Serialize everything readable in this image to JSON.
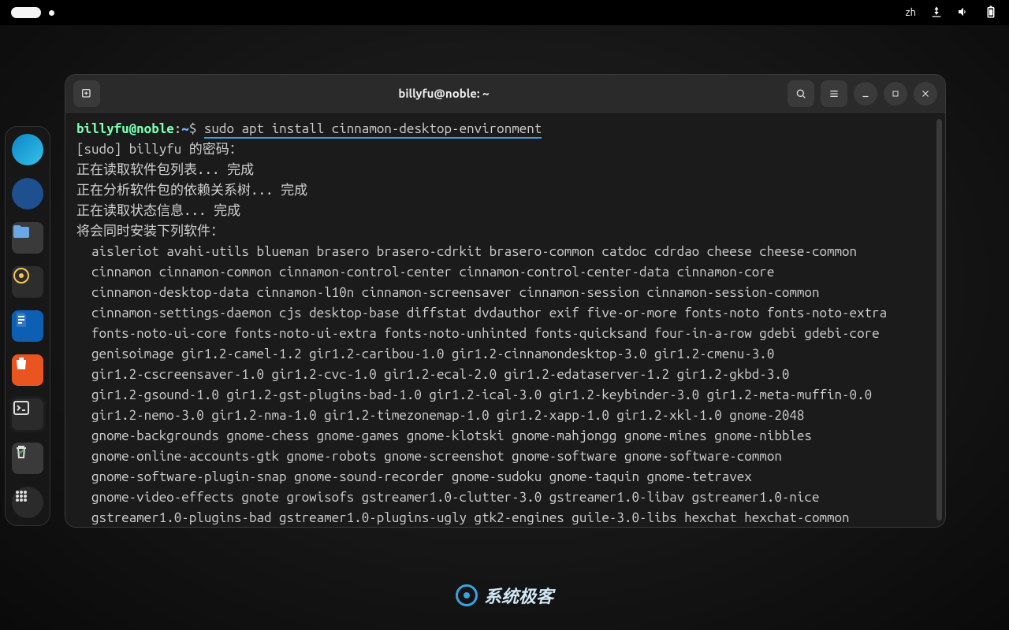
{
  "topbar": {
    "lang": "zh"
  },
  "dock": {
    "items": [
      {
        "name": "edge-browser-icon"
      },
      {
        "name": "thunderbird-icon"
      },
      {
        "name": "files-icon"
      },
      {
        "name": "rhythmbox-icon"
      },
      {
        "name": "libreoffice-writer-icon"
      },
      {
        "name": "software-store-icon"
      },
      {
        "name": "terminal-icon"
      },
      {
        "name": "trash-icon"
      },
      {
        "name": "app-grid-icon"
      }
    ]
  },
  "window": {
    "title": "billyfu@noble: ~"
  },
  "prompt": {
    "user": "billyfu@noble",
    "sep": ":",
    "path": "~",
    "dollar": "$",
    "command": "sudo apt install cinnamon-desktop-environment"
  },
  "lines": {
    "sudo_prompt": "[sudo] billyfu 的密码：",
    "read_pkgs": "正在读取软件包列表... 完成",
    "dep_tree": "正在分析软件包的依赖关系树... 完成",
    "read_state": "正在读取状态信息... 完成",
    "will_install": "将会同时安装下列软件：",
    "pkg01": "aisleriot avahi-utils blueman brasero brasero-cdrkit brasero-common catdoc cdrdao cheese cheese-common",
    "pkg02": "cinnamon cinnamon-common cinnamon-control-center cinnamon-control-center-data cinnamon-core",
    "pkg03": "cinnamon-desktop-data cinnamon-l10n cinnamon-screensaver cinnamon-session cinnamon-session-common",
    "pkg04": "cinnamon-settings-daemon cjs desktop-base diffstat dvdauthor exif five-or-more fonts-noto fonts-noto-extra",
    "pkg05": "fonts-noto-ui-core fonts-noto-ui-extra fonts-noto-unhinted fonts-quicksand four-in-a-row gdebi gdebi-core",
    "pkg06": "genisoimage gir1.2-camel-1.2 gir1.2-caribou-1.0 gir1.2-cinnamondesktop-3.0 gir1.2-cmenu-3.0",
    "pkg07": "gir1.2-cscreensaver-1.0 gir1.2-cvc-1.0 gir1.2-ecal-2.0 gir1.2-edataserver-1.2 gir1.2-gkbd-3.0",
    "pkg08": "gir1.2-gsound-1.0 gir1.2-gst-plugins-bad-1.0 gir1.2-ical-3.0 gir1.2-keybinder-3.0 gir1.2-meta-muffin-0.0",
    "pkg09": "gir1.2-nemo-3.0 gir1.2-nma-1.0 gir1.2-timezonemap-1.0 gir1.2-xapp-1.0 gir1.2-xkl-1.0 gnome-2048",
    "pkg10": "gnome-backgrounds gnome-chess gnome-games gnome-klotski gnome-mahjongg gnome-mines gnome-nibbles",
    "pkg11": "gnome-online-accounts-gtk gnome-robots gnome-screenshot gnome-software gnome-software-common",
    "pkg12": "gnome-software-plugin-snap gnome-sound-recorder gnome-sudoku gnome-taquin gnome-tetravex",
    "pkg13": "gnome-video-effects gnote growisofs gstreamer1.0-clutter-3.0 gstreamer1.0-libav gstreamer1.0-nice",
    "pkg14": "gstreamer1.0-plugins-bad gstreamer1.0-plugins-ugly gtk2-engines guile-3.0-libs hexchat hexchat-common"
  },
  "watermark": {
    "text": "系统极客"
  }
}
